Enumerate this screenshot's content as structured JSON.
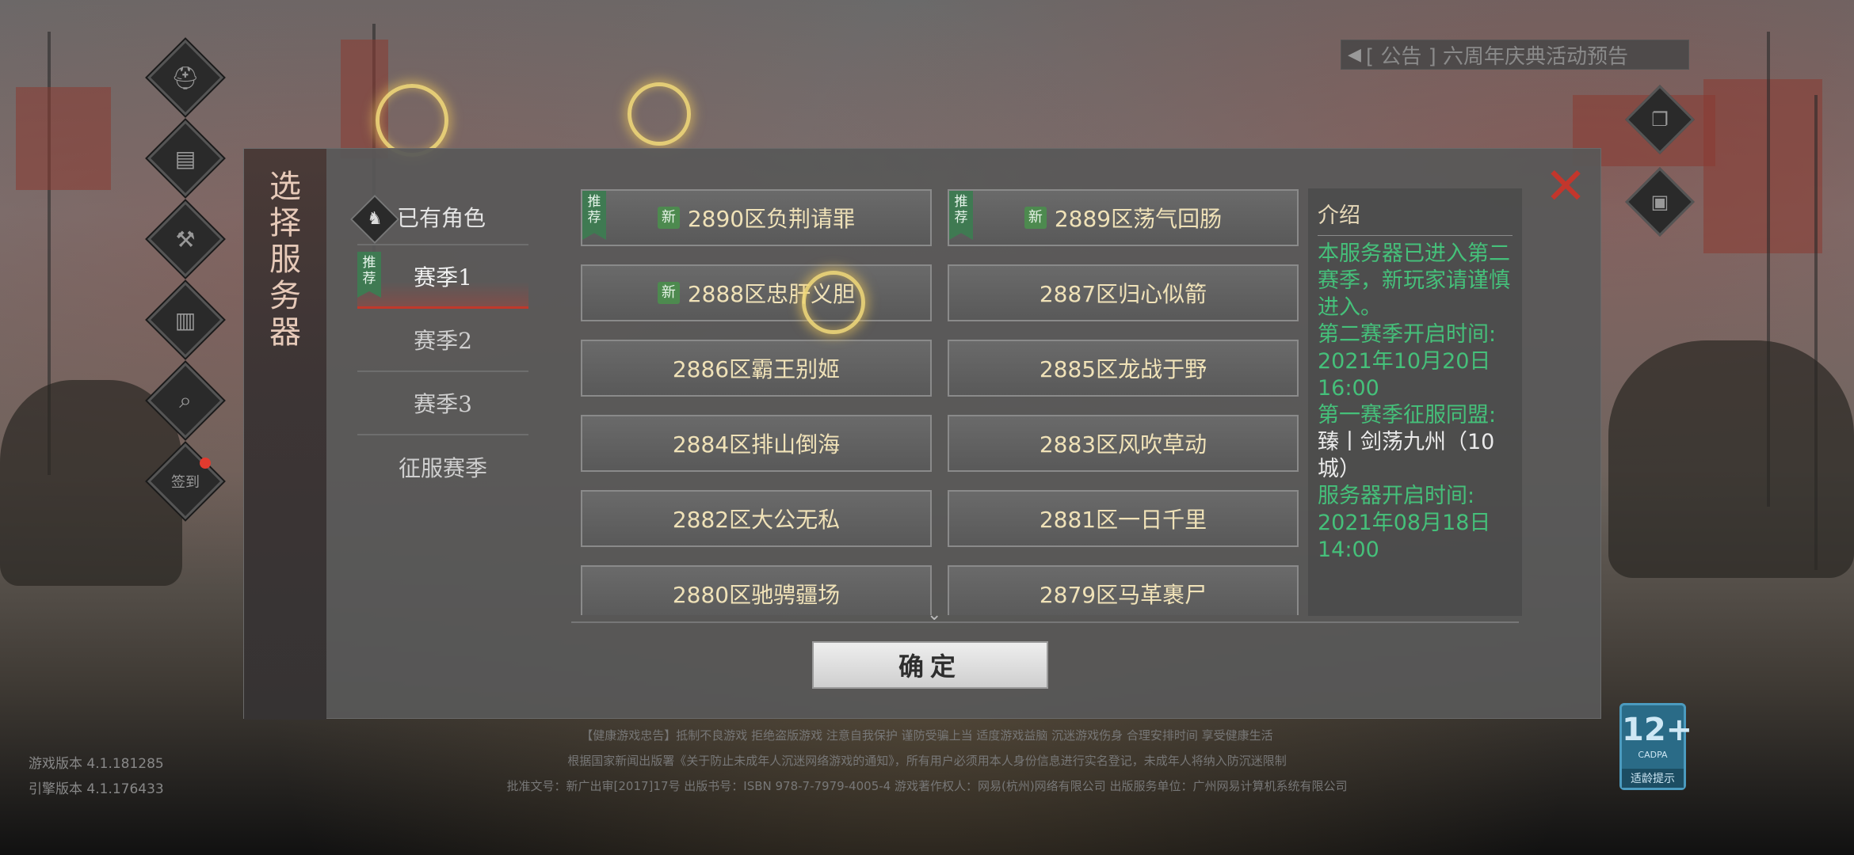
{
  "announcement": {
    "icon": "speaker-icon",
    "text": "[ 公告 ] 六周年庆典活动预告"
  },
  "left_icons": [
    "helmet-icon",
    "scroll-icon",
    "hammer-icon",
    "gate-icon",
    "search-general-icon",
    "checkin-icon"
  ],
  "checkin_label": "签到",
  "right_icons": [
    "copy-icon",
    "box-icon"
  ],
  "dialog": {
    "title": "选择服务器",
    "close_label": "✕",
    "tabs": [
      {
        "label": "已有角色",
        "icon": "hero-portrait-icon"
      },
      {
        "label": "赛季1",
        "recommend": "推荐",
        "active": true
      },
      {
        "label": "赛季2"
      },
      {
        "label": "赛季3"
      },
      {
        "label": "征服赛季"
      }
    ],
    "servers": [
      {
        "name": "2890区负荆请罪",
        "recommend": "推荐",
        "new": "新"
      },
      {
        "name": "2889区荡气回肠",
        "recommend": "推荐",
        "new": "新"
      },
      {
        "name": "2888区忠肝义胆",
        "new": "新"
      },
      {
        "name": "2887区归心似箭"
      },
      {
        "name": "2886区霸王别姬"
      },
      {
        "name": "2885区龙战于野"
      },
      {
        "name": "2884区排山倒海"
      },
      {
        "name": "2883区风吹草动"
      },
      {
        "name": "2882区大公无私"
      },
      {
        "name": "2881区一日千里"
      },
      {
        "name": "2880区驰骋疆场"
      },
      {
        "name": "2879区马革裹尸"
      }
    ],
    "intro": {
      "heading": "介绍",
      "line1": "本服务器已进入第二赛季，新玩家请谨慎进入。",
      "line2": "第二赛季开启时间:",
      "line3": "2021年10月20日16:00",
      "line4": "第一赛季征服同盟:",
      "line5": "臻丨剑荡九州（10城）",
      "line6": "服务器开启时间:",
      "line7": "2021年08月18日14:00"
    },
    "confirm_label": "确定"
  },
  "version": {
    "game": "游戏版本  4.1.181285",
    "engine": "引擎版本  4.1.176433"
  },
  "footer": {
    "line1": "【健康游戏忠告】抵制不良游戏  拒绝盗版游戏  注意自我保护  谨防受骗上当  适度游戏益脑  沉迷游戏伤身  合理安排时间  享受健康生活",
    "line2": "根据国家新闻出版署《关于防止未成年人沉迷网络游戏的通知》，所有用户必须用本人身份信息进行实名登记，未成年人将纳入防沉迷限制",
    "line3": "批准文号：新广出审[2017]17号 出版书号：ISBN 978-7-7979-4005-4 游戏著作权人：网易(杭州)网络有限公司 出版服务单位：广州网易计算机系统有限公司"
  },
  "age_rating": {
    "value": "12+",
    "org": "CADPA",
    "tip": "适龄提示"
  },
  "colors": {
    "intro_green": "#45c07a",
    "server_text": "#f0e2b8",
    "accent_red": "#c3362c",
    "recommend_green": "#3f7a52"
  }
}
